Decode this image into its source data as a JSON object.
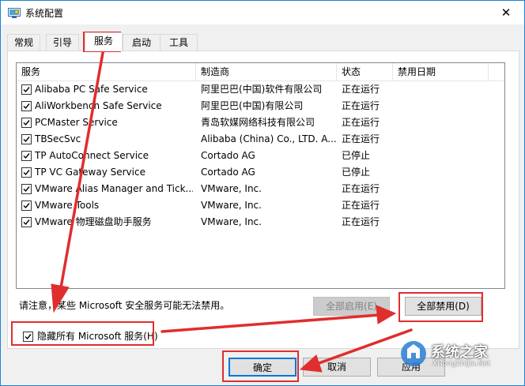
{
  "window": {
    "title": "系统配置",
    "close_glyph": "✕"
  },
  "tabs": [
    {
      "label": "常规"
    },
    {
      "label": "引导"
    },
    {
      "label": "服务"
    },
    {
      "label": "启动"
    },
    {
      "label": "工具"
    }
  ],
  "services": {
    "columns": [
      "服务",
      "制造商",
      "状态",
      "禁用日期"
    ],
    "rows": [
      {
        "checked": true,
        "name": "Alibaba PC Safe Service",
        "vendor": "阿里巴巴(中国)软件有限公司",
        "status": "正在运行",
        "disabled_date": ""
      },
      {
        "checked": true,
        "name": "AliWorkbench Safe Service",
        "vendor": "阿里巴巴(中国)有限公司",
        "status": "正在运行",
        "disabled_date": ""
      },
      {
        "checked": true,
        "name": "PCMaster Service",
        "vendor": "青岛软媒网络科技有限公司",
        "status": "正在运行",
        "disabled_date": ""
      },
      {
        "checked": true,
        "name": "TBSecSvc",
        "vendor": "Alibaba (China) Co., LTD. A...",
        "status": "正在运行",
        "disabled_date": ""
      },
      {
        "checked": true,
        "name": "TP AutoConnect Service",
        "vendor": "Cortado AG",
        "status": "已停止",
        "disabled_date": ""
      },
      {
        "checked": true,
        "name": "TP VC Gateway Service",
        "vendor": "Cortado AG",
        "status": "已停止",
        "disabled_date": ""
      },
      {
        "checked": true,
        "name": "VMware Alias Manager and Tick...",
        "vendor": "VMware, Inc.",
        "status": "正在运行",
        "disabled_date": ""
      },
      {
        "checked": true,
        "name": "VMware Tools",
        "vendor": "VMware, Inc.",
        "status": "正在运行",
        "disabled_date": ""
      },
      {
        "checked": true,
        "name": "VMware 物理磁盘助手服务",
        "vendor": "VMware, Inc.",
        "status": "正在运行",
        "disabled_date": ""
      }
    ]
  },
  "notice": "请注意，某些 Microsoft 安全服务可能无法禁用。",
  "buttons": {
    "enable_all": "全部启用(E)",
    "disable_all": "全部禁用(D)",
    "ok": "确定",
    "cancel": "取消",
    "apply": "应用"
  },
  "hide_microsoft": {
    "label": "隐藏所有 Microsoft 服务(H)",
    "checked": true
  },
  "watermark": {
    "text": "系统之家",
    "subtext": "XiTongZhiJia.Net"
  },
  "colors": {
    "annotation_red": "#e02e2e",
    "accent_blue": "#1883d7"
  }
}
